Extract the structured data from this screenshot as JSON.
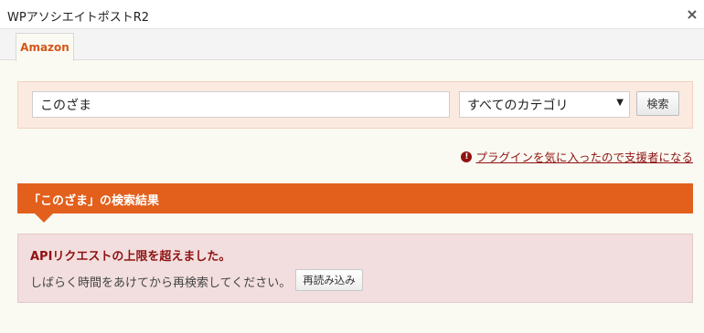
{
  "window": {
    "title": "WPアソシエイトポストR2",
    "close_label": "×"
  },
  "tabs": [
    {
      "label": "Amazon",
      "active": true
    }
  ],
  "search": {
    "query": "このざま",
    "category_selected": "すべてのカテゴリ",
    "button_label": "検索"
  },
  "support": {
    "icon": "exclamation-circle-icon",
    "link_text": "プラグインを気に入ったので支援者になる"
  },
  "results": {
    "header": "「このざま」の検索結果"
  },
  "error": {
    "title": "APIリクエストの上限を超えました。",
    "message": "しばらく時間をあけてから再検索してください。",
    "reload_label": "再読み込み"
  },
  "colors": {
    "accent": "#e2601c",
    "tab_text": "#d4561a",
    "error_text": "#8f1212",
    "error_bg": "#f2dede",
    "search_panel_bg": "#fbeae0"
  }
}
